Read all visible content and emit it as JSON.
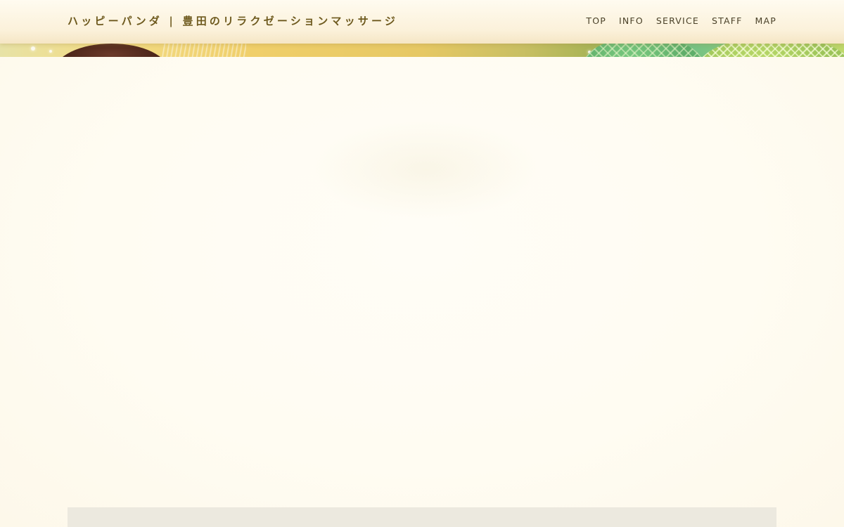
{
  "header": {
    "site_title": "ハッピーパンダ | 豊田のリラクゼーションマッサージ",
    "nav": [
      {
        "label": "TOP"
      },
      {
        "label": "INFO"
      },
      {
        "label": "SERVICE"
      },
      {
        "label": "STAFF"
      },
      {
        "label": "MAP"
      }
    ]
  },
  "colors": {
    "background": "#fffcf3",
    "title_text": "#6e5a1e",
    "nav_text": "#4a4128",
    "panel": "#ece9df"
  }
}
